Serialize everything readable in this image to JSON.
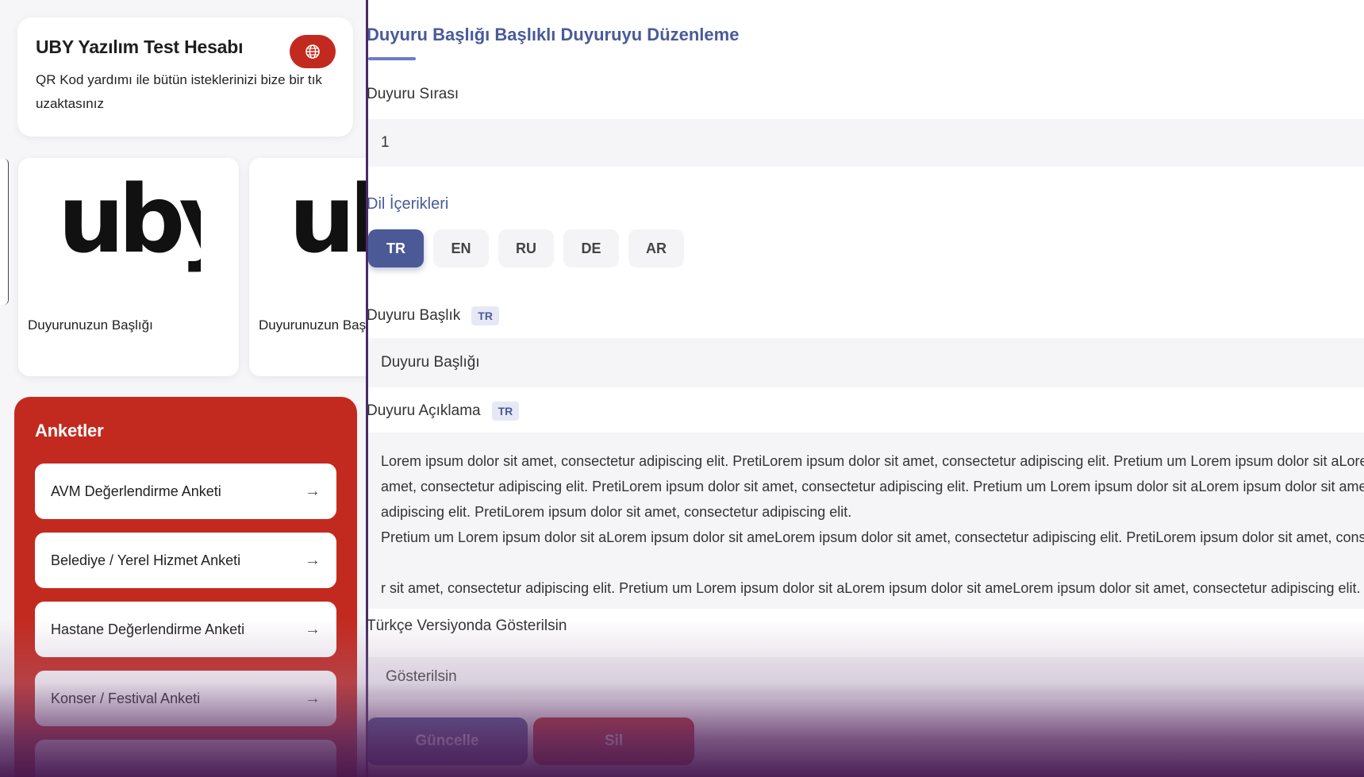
{
  "account": {
    "title": "UBY Yazılım Test Hesabı",
    "description": "QR Kod yardımı ile bütün isteklerinizi bize bir tık uzaktasınız",
    "globe_icon": "globe-icon"
  },
  "announcements": [
    {
      "logo": "uby-logo",
      "caption": "Duyurunuzun Başlığı"
    },
    {
      "logo": "uby-logo",
      "caption": "Duyurunuzun Başlığı"
    }
  ],
  "surveys": {
    "heading": "Anketler",
    "items": [
      {
        "label": "AVM Değerlendirme Anketi"
      },
      {
        "label": "Belediye / Yerel Hizmet Anketi"
      },
      {
        "label": "Hastane Değerlendirme Anketi"
      },
      {
        "label": "Konser / Festival Anketi"
      }
    ],
    "arrow_icon": "arrow-right-icon"
  },
  "form": {
    "title": "Duyuru Başlığı Başlıklı Duyuruyu Düzenleme",
    "order_label": "Duyuru Sırası",
    "order_value": "1",
    "lang_section_title": "Dil İçerikleri",
    "lang_tabs": [
      "TR",
      "EN",
      "RU",
      "DE",
      "AR"
    ],
    "active_lang": "TR",
    "title_label": "Duyuru Başlık",
    "title_lang": "TR",
    "title_value": "Duyuru Başlığı",
    "desc_label": "Duyuru Açıklama",
    "desc_lang": "TR",
    "desc_value": "Lorem ipsum dolor sit amet, consectetur adipiscing elit. PretiLorem ipsum dolor sit amet, consectetur adipiscing elit. Pretium um Lorem ipsum dolor sit aLorem ipsum dolor sit ameLorem ipsum dolor sit\namet, consectetur adipiscing elit. PretiLorem ipsum dolor sit amet, consectetur adipiscing elit. Pretium um Lorem ipsum dolor sit aLorem ipsum dolor sit ameLorem ipsum dolor sit amet, consectetur\nadipiscing elit. PretiLorem ipsum dolor sit amet, consectetur adipiscing elit.\nPretium um Lorem ipsum dolor sit aLorem ipsum dolor sit ameLorem ipsum dolor sit amet, consectetur adipiscing elit. PretiLorem ipsum dolor sit amet, consectetur adipiscing elit. Pretium um Lorem ipsum dolo\n\nr sit amet, consectetur adipiscing elit. Pretium um Lorem ipsum dolor sit aLorem ipsum dolor sit ameLorem ipsum dolor sit amet, consectetur adipiscing elit.",
    "show_label": "Türkçe Versiyonda Gösterilsin",
    "show_value": "Gösterilsin",
    "update_button": "Güncelle",
    "delete_button": "Sil"
  },
  "colors": {
    "brand_red": "#c32a1f",
    "brand_blue": "#4b5a96",
    "divider": "#4a2a6a"
  }
}
